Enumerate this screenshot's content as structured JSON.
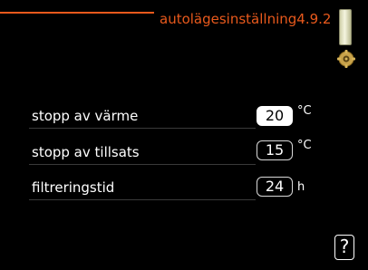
{
  "header": {
    "title": "autolägesinställning4.9.2",
    "accent_color": "#e8591c"
  },
  "icons": {
    "thermometer": "thermometer-icon",
    "settings": "gear-icon"
  },
  "settings": [
    {
      "label": "stopp av värme",
      "value": "20",
      "unit": "°C",
      "selected": true
    },
    {
      "label": "stopp av tillsats",
      "value": "15",
      "unit": "°C",
      "selected": false
    },
    {
      "label": "filtreringstid",
      "value": "24",
      "unit": "h",
      "selected": false
    }
  ],
  "help": {
    "label": "?"
  }
}
